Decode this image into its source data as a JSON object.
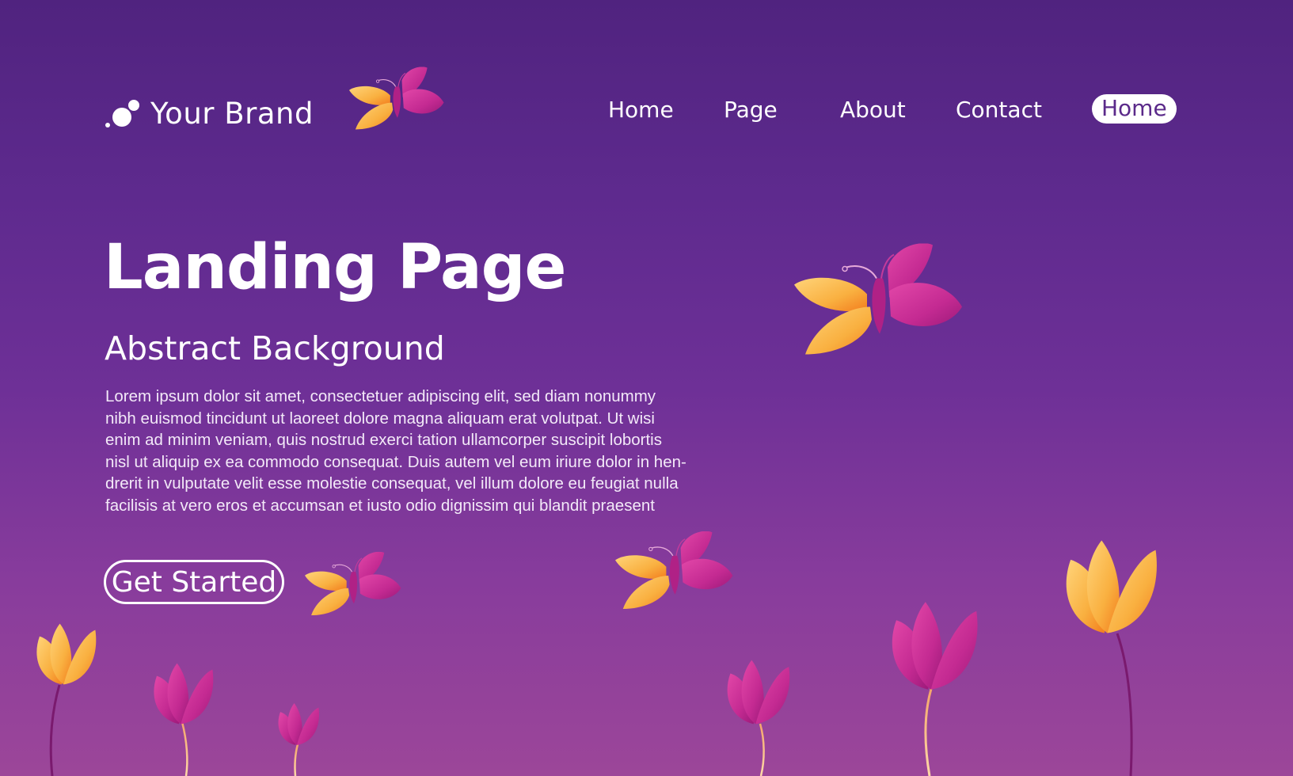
{
  "header": {
    "brand_name": "Your Brand",
    "brand_logo_icon": "bubbles-logo-icon"
  },
  "nav": {
    "items": [
      {
        "label": "Home",
        "active": false
      },
      {
        "label": "Page",
        "active": false
      },
      {
        "label": "About",
        "active": false
      },
      {
        "label": "Contact",
        "active": false
      },
      {
        "label": "Home",
        "active": true
      }
    ]
  },
  "hero": {
    "title": "Landing Page",
    "subtitle": "Abstract Background",
    "body_lines": [
      "Lorem ipsum dolor sit amet, consectetuer adipiscing elit, sed diam nonummy",
      "nibh euismod tincidunt ut laoreet dolore magna aliquam erat volutpat. Ut wisi",
      "enim ad minim veniam, quis nostrud exerci tation ullamcorper suscipit lobortis",
      "nisl ut aliquip ex ea commodo consequat. Duis autem vel eum iriure dolor in hen-",
      "drerit in vulputate velit esse molestie consequat, vel illum dolore eu feugiat nulla",
      "facilisis at vero eros et accumsan et iusto odio dignissim qui blandit praesent"
    ],
    "cta_label": "Get Started"
  },
  "decorations": {
    "butterflies": [
      "butterfly-icon",
      "butterfly-icon",
      "butterfly-icon",
      "butterfly-icon"
    ],
    "flowers": [
      "tulip-orange",
      "tulip-magenta",
      "tulip-magenta",
      "tulip-magenta",
      "tulip-magenta",
      "tulip-orange"
    ]
  },
  "colors": {
    "background_top": "#50237f",
    "background_bottom": "#9c4699",
    "accent_orange": "#f7a531",
    "accent_magenta": "#c42a92",
    "pill_text": "#5b2a8a"
  }
}
